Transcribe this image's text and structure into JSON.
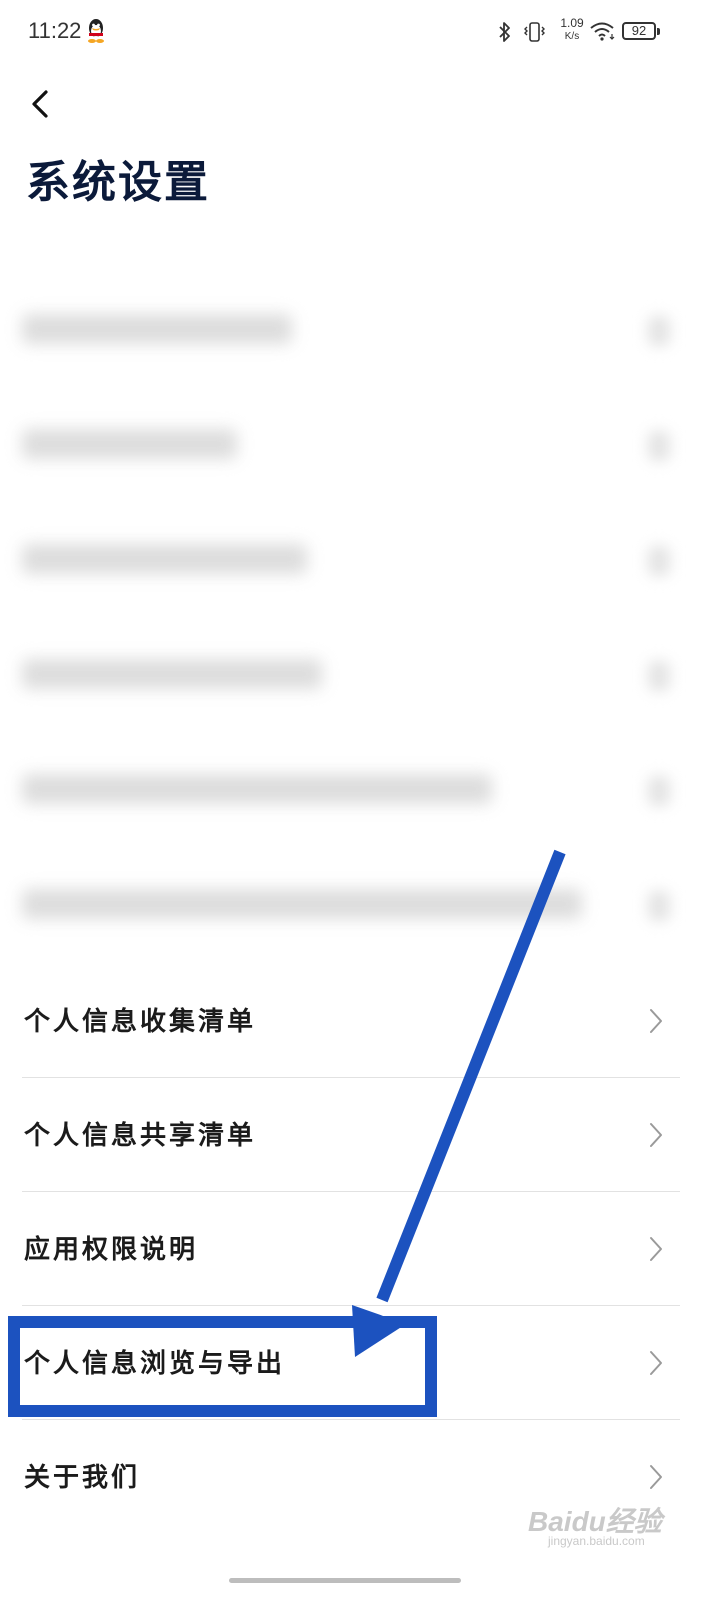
{
  "status_bar": {
    "time": "11:22",
    "net_speed_value": "1.09",
    "net_speed_unit": "K/s",
    "battery": "92",
    "icons": [
      "qq-icon",
      "bluetooth-icon",
      "vibrate-icon",
      "wifi-icon",
      "battery-icon"
    ]
  },
  "header": {
    "back_icon": "chevron-left-icon",
    "title": "系统设置"
  },
  "blurred_rows_count": 6,
  "settings": {
    "items": [
      {
        "label": "个人信息收集清单"
      },
      {
        "label": "个人信息共享清单"
      },
      {
        "label": "应用权限说明"
      },
      {
        "label": "个人信息浏览与导出"
      },
      {
        "label": "关于我们"
      }
    ]
  },
  "annotation": {
    "highlighted_item": "个人信息浏览与导出",
    "color": "#1c52bf"
  },
  "watermark": {
    "text": "Baidu经验",
    "sub": "jingyan.baidu.com"
  },
  "colors": {
    "title": "#0b1a3a",
    "accent": "#1c52bf",
    "divider": "#e2e2e2"
  }
}
